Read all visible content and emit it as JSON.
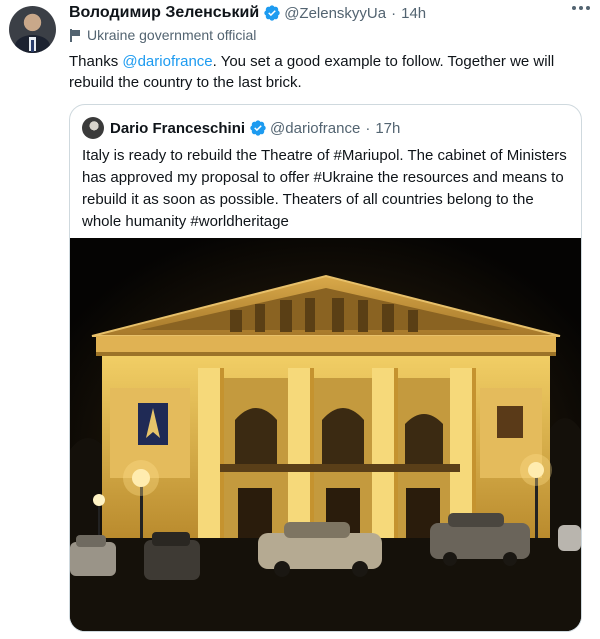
{
  "tweet": {
    "author_name": "Володимир Зеленський",
    "author_handle": "@ZelenskyyUa",
    "separator": "·",
    "time": "14h",
    "label": "Ukraine government official",
    "text_before": "Thanks ",
    "mention": "@dariofrance",
    "text_after": ". You set a good example to follow. Together we will rebuild the country to the last brick."
  },
  "quoted": {
    "author_name": "Dario Franceschini",
    "author_handle": "@dariofrance",
    "separator": "·",
    "time": "17h",
    "text": "Italy is ready to rebuild the Theatre of #Mariupol. The cabinet of Ministers has approved my proposal to offer #Ukraine the resources and means to  rebuild it as soon as possible. Theaters of all countries belong to the whole humanity #worldheritage"
  },
  "icons": {
    "verified": "verified-badge-icon",
    "more": "more-options-icon",
    "label_flag": "flag-icon"
  },
  "colors": {
    "accent": "#1d9bf0",
    "secondary_text": "#536471",
    "border": "#cfd9de"
  }
}
